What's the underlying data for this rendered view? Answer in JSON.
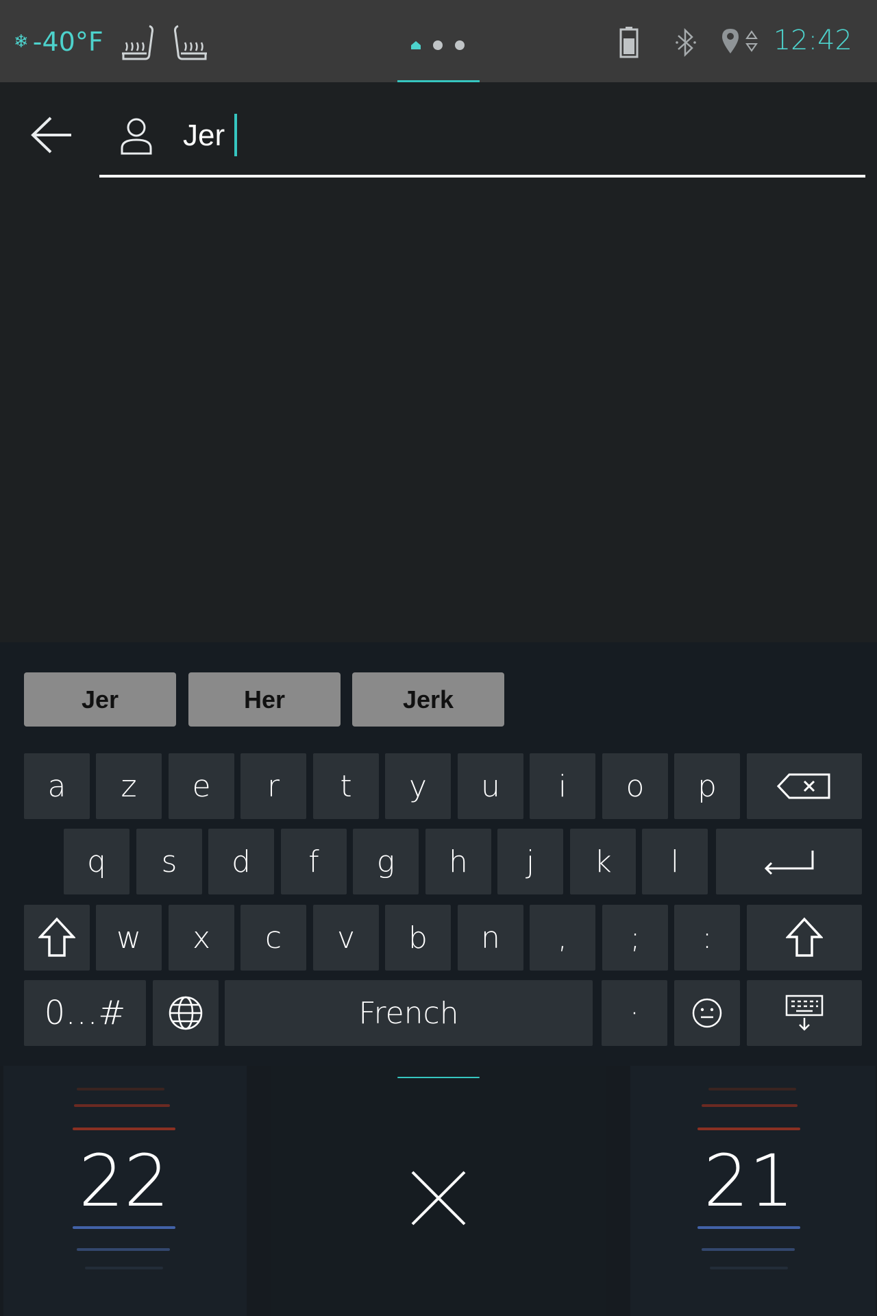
{
  "status_bar": {
    "outside_temp": "-40°F",
    "clock": "12:42",
    "colors": {
      "accent": "#4dd2cc",
      "background": "#3a3a3a"
    },
    "icons": [
      "snowflake-icon",
      "seat-heat-front-icon",
      "seat-heat-rear-icon",
      "home-icon",
      "battery-icon",
      "bluetooth-icon",
      "location-icon"
    ]
  },
  "search": {
    "value": "Jer",
    "icons": [
      "back-arrow-icon",
      "user-icon"
    ]
  },
  "keyboard": {
    "suggestions": [
      "Jer",
      "Her",
      "Jerk"
    ],
    "rows": [
      [
        "a",
        "z",
        "e",
        "r",
        "t",
        "y",
        "u",
        "i",
        "o",
        "p"
      ],
      [
        "q",
        "s",
        "d",
        "f",
        "g",
        "h",
        "j",
        "k",
        "l"
      ],
      [
        "w",
        "x",
        "c",
        "v",
        "b",
        "n",
        ",",
        ";",
        ":"
      ]
    ],
    "symbols_key": "0…#",
    "space_label": "French",
    "period_key": "·",
    "special_icons": [
      "backspace-icon",
      "enter-icon",
      "shift-icon",
      "globe-icon",
      "emoji-icon",
      "hide-keyboard-icon"
    ]
  },
  "climate": {
    "left_temp": "22",
    "right_temp": "21",
    "colors": {
      "heat": "#7a2a1e",
      "cool": "#3d5a94"
    }
  }
}
